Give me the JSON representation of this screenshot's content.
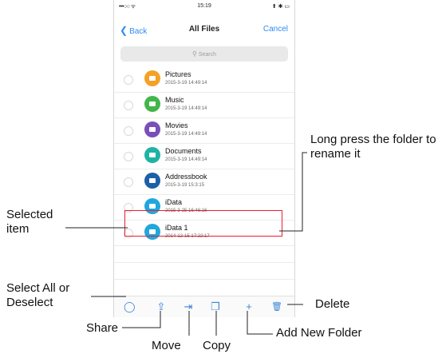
{
  "status_bar": {
    "carrier": "•••○○ ᯤ",
    "time": "15:19",
    "battery": "⬆ ✱ ▭"
  },
  "nav": {
    "back_label": "Back",
    "back_chevron": "❮",
    "title": "All Files",
    "cancel_label": "Cancel"
  },
  "search": {
    "placeholder": "Search",
    "icon_glyph": "⚲"
  },
  "files": [
    {
      "name": "Pictures",
      "date": "2015-3-19 14:49:14",
      "color": "#f4a126"
    },
    {
      "name": "Music",
      "date": "2015-3-19 14:49:14",
      "color": "#43b649"
    },
    {
      "name": "Movies",
      "date": "2015-3-19 14:49:14",
      "color": "#7a4fb8"
    },
    {
      "name": "Documents",
      "date": "2015-3-19 14:49:14",
      "color": "#1fb3a4"
    },
    {
      "name": "Addressbook",
      "date": "2015-3-19 15:3:15",
      "color": "#1d5fa8"
    },
    {
      "name": "iData",
      "date": "2015-3-25 16:46:16",
      "color": "#21a7dd"
    },
    {
      "name": "iData 1",
      "date": "2014-12-15 17:22:17",
      "color": "#21a7dd"
    }
  ],
  "toolbar": {
    "select_all_glyph": "◯",
    "share_glyph": "⇪",
    "move_glyph": "⇥",
    "copy_glyph": "❐",
    "add_glyph": "+",
    "delete_glyph": "🗑"
  },
  "callouts": {
    "long_press": "Long press the folder to rename it",
    "selected_item": "Selected item",
    "select_all": "Select All or Deselect",
    "delete": "Delete",
    "share": "Share",
    "move": "Move",
    "copy": "Copy",
    "add_folder": "Add New Folder"
  },
  "colors": {
    "accent": "#2f8cf0",
    "selection_border": "#e5202e",
    "tool_icon": "#3b86d9"
  }
}
